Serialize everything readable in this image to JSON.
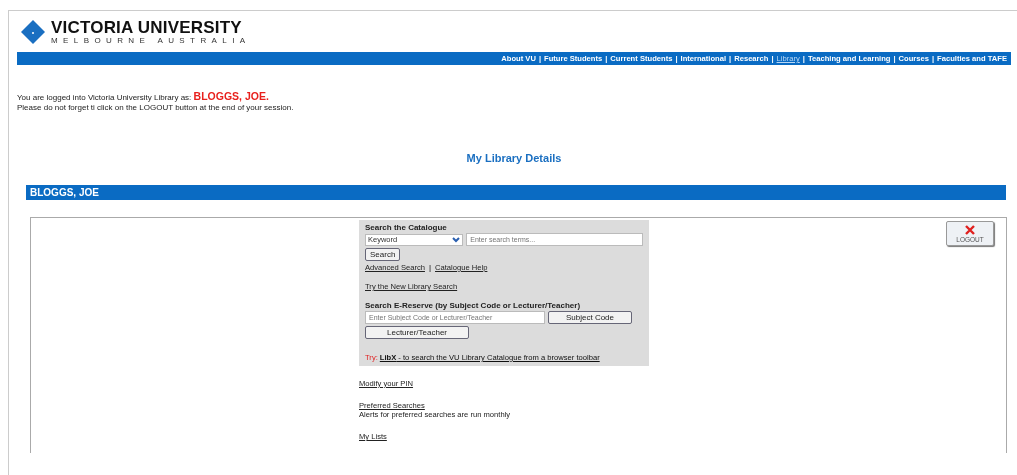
{
  "logo": {
    "name": "VICTORIA UNIVERSITY",
    "tagline": "MELBOURNE AUSTRALIA"
  },
  "nav": [
    {
      "label": "About VU",
      "selected": false
    },
    {
      "label": "Future Students",
      "selected": false
    },
    {
      "label": "Current Students",
      "selected": false
    },
    {
      "label": "International",
      "selected": false
    },
    {
      "label": "Research",
      "selected": false
    },
    {
      "label": "Library",
      "selected": true
    },
    {
      "label": "Teaching and Learning",
      "selected": false
    },
    {
      "label": "Courses",
      "selected": false
    },
    {
      "label": "Faculties and TAFE",
      "selected": false
    }
  ],
  "nav_separator": "|",
  "login": {
    "prefix": "You are logged into Victoria University Library as:",
    "user": "BLOGGS, JOE.",
    "reminder": "Please do not forget ti click on the LOGOUT button at the end of your session."
  },
  "page_title": "My Library Details",
  "name_bar": "BLOGGS, JOE",
  "logout_button": "LOGOUT",
  "catalogue": {
    "heading": "Search the Catalogue",
    "select_value": "Keyword",
    "search_placeholder": "Enter search terms...",
    "search_button": "Search",
    "links": [
      "Advanced Search",
      "Catalogue Help"
    ],
    "separator": "|",
    "new_search_link": "Try the New Library Search"
  },
  "ereserve": {
    "heading": "Search E-Reserve (by Subject Code or Lecturer/Teacher)",
    "placeholder": "Enter Subject Code or Lecturer/Teacher",
    "buttons": [
      "Subject Code",
      "Lecturer/Teacher"
    ]
  },
  "try": {
    "label": "Try:",
    "link_bold": "LibX",
    "link_rest": " - to search the VU Library Catalogue from a browser toolbar"
  },
  "options": [
    {
      "link": "Modify your PIN"
    },
    {
      "link": "Preferred Searches",
      "note": "Alerts for preferred searches are run monthly"
    },
    {
      "link": "My Lists"
    }
  ]
}
